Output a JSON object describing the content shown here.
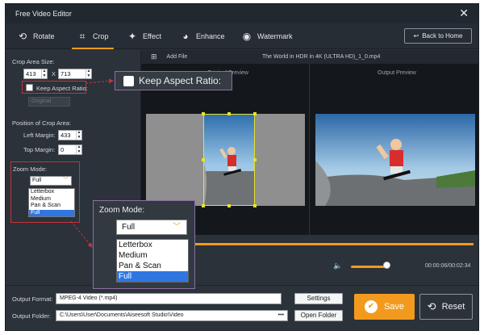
{
  "window": {
    "title": "Free Video Editor",
    "close_glyph": "✕"
  },
  "tabs": [
    {
      "label": "Rotate",
      "icon": "rotate-icon",
      "glyph": "⟲"
    },
    {
      "label": "Crop",
      "icon": "crop-icon",
      "glyph": "⌗"
    },
    {
      "label": "Effect",
      "icon": "effect-icon",
      "glyph": "✦"
    },
    {
      "label": "Enhance",
      "icon": "palette-icon",
      "glyph": "◕"
    },
    {
      "label": "Watermark",
      "icon": "watermark-icon",
      "glyph": "◉"
    }
  ],
  "active_tab": "Crop",
  "back_button": {
    "label": "Back to Home",
    "glyph": "↩"
  },
  "crop": {
    "area_label": "Crop Area Size:",
    "width": "413",
    "x_sep": "X",
    "height": "713",
    "keep_aspect_label": "Keep Aspect Ratio:",
    "aspect_value": "Original",
    "position_label": "Position of Crop Area:",
    "left_margin_label": "Left Margin:",
    "left_margin": "433",
    "top_margin_label": "Top Margin:",
    "top_margin": "0"
  },
  "zoom": {
    "label": "Zoom Mode:",
    "selected": "Full",
    "options": [
      "Letterbox",
      "Medium",
      "Pan & Scan",
      "Full"
    ]
  },
  "preview": {
    "add_file": "Add File",
    "file_name": "The World in HDR in 4K (ULTRA HD)_1_0.mp4",
    "original_label": "Original Preview",
    "output_label": "Output Preview",
    "progress": 1.0,
    "volume": 0.85,
    "time": "00:00:06/00:02:34"
  },
  "output": {
    "format_label": "Output Format:",
    "format_value": "MPEG-4 Video (*.mp4)",
    "settings_label": "Settings",
    "folder_label": "Output Folder:",
    "folder_value": "C:\\Users\\User\\Documents\\Aiseesoft Studio\\Video",
    "ellipsis": "•••",
    "open_folder_label": "Open Folder",
    "save_label": "Save",
    "reset_label": "Reset"
  },
  "colors": {
    "accent": "#f29a1e",
    "background": "#2b323a",
    "highlight": "#c8323a",
    "callout_border": "#8b6fa5"
  }
}
